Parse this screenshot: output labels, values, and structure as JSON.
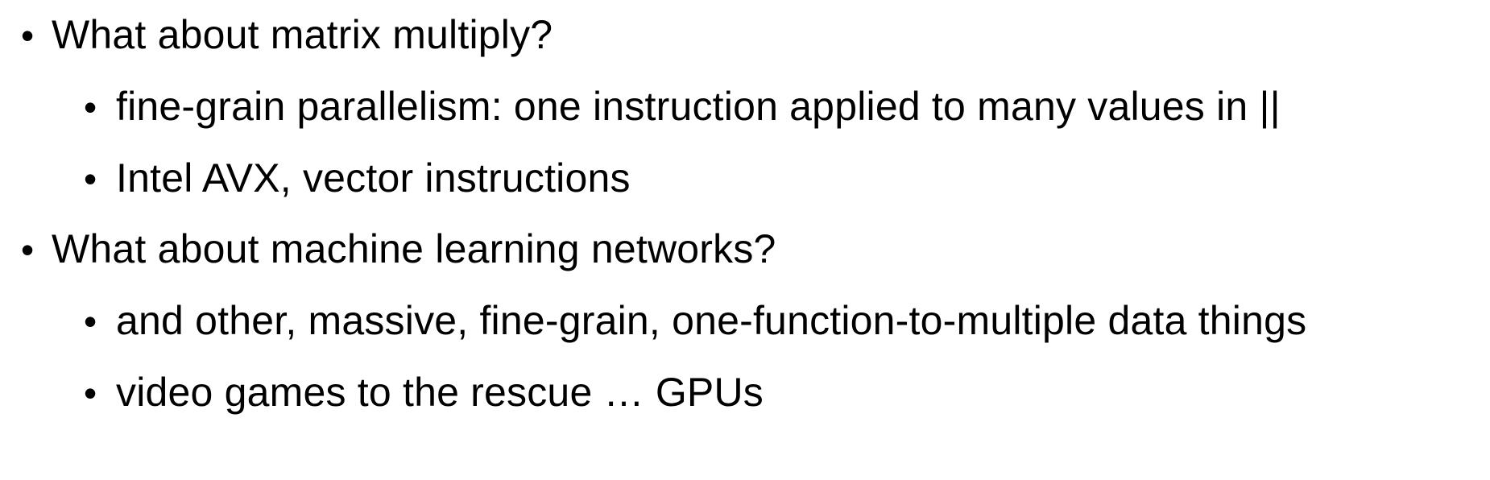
{
  "slide": {
    "bullet_glyph": "•",
    "items": [
      {
        "level": 1,
        "text": "What about matrix multiply?"
      },
      {
        "level": 2,
        "text": "fine-grain parallelism: one instruction applied to many values in ||"
      },
      {
        "level": 2,
        "text": "Intel AVX, vector instructions"
      },
      {
        "level": 1,
        "text": "What about machine learning networks?"
      },
      {
        "level": 2,
        "text": "and other, massive, fine-grain, one-function-to-multiple data things"
      },
      {
        "level": 2,
        "text": "video games to the rescue … GPUs"
      }
    ]
  }
}
